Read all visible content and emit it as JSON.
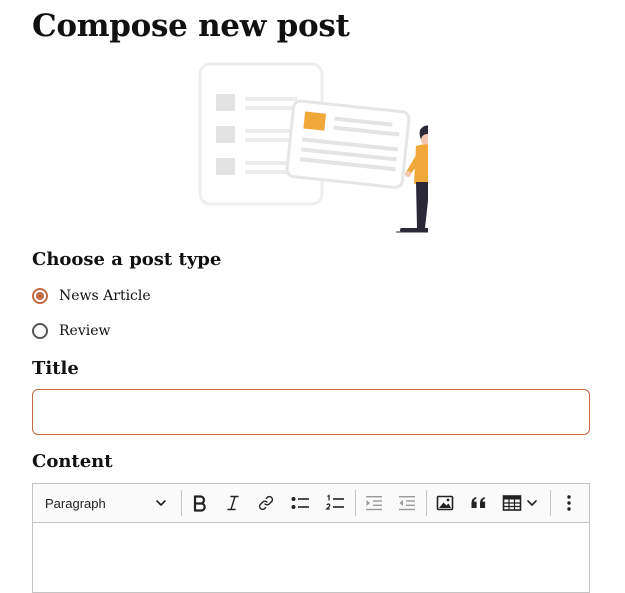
{
  "page": {
    "title": "Compose new post"
  },
  "post_type": {
    "label": "Choose a post type",
    "options": [
      {
        "label": "News Article",
        "selected": true
      },
      {
        "label": "Review",
        "selected": false
      }
    ]
  },
  "title_field": {
    "label": "Title",
    "value": ""
  },
  "content_field": {
    "label": "Content",
    "toolbar": {
      "block_format": "Paragraph",
      "buttons": [
        "bold-icon",
        "italic-icon",
        "link-icon",
        "bulleted-list-icon",
        "numbered-list-icon",
        "outdent-icon",
        "indent-icon",
        "image-icon",
        "blockquote-icon",
        "table-icon",
        "more-options-icon"
      ]
    },
    "value": ""
  },
  "colors": {
    "accent": "#c46a44",
    "illustration_accent": "#f0a83a",
    "illustration_figure": "#2b2838",
    "border": "#c4c4c4"
  }
}
